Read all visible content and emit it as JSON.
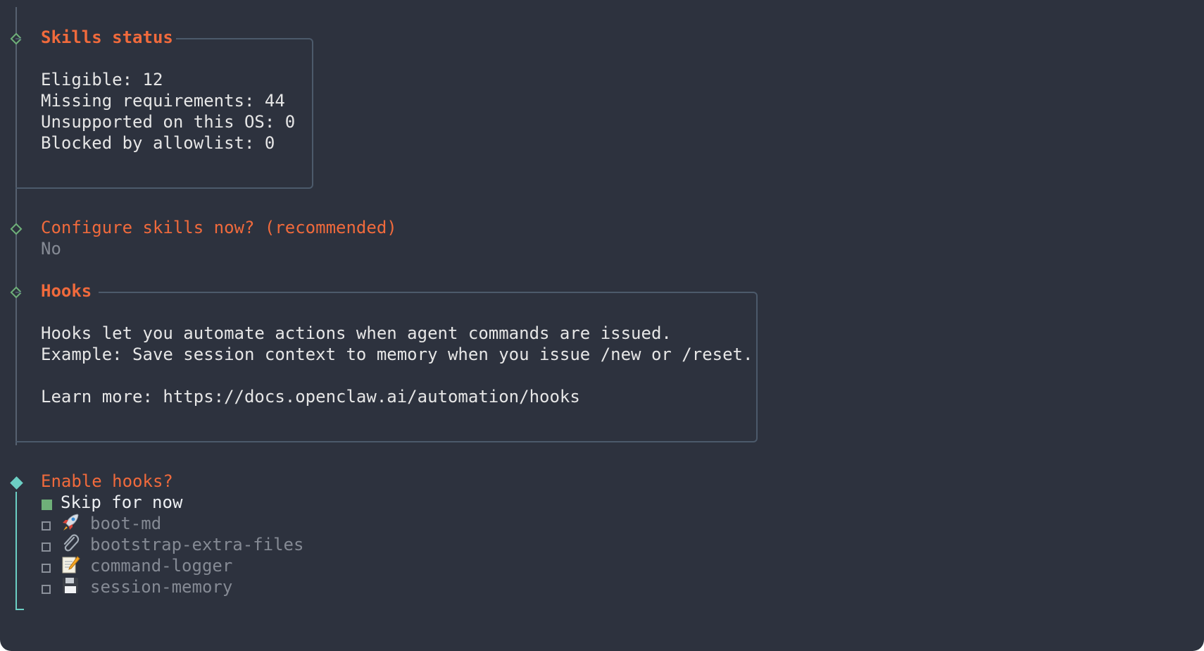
{
  "skills_status": {
    "title": "Skills status",
    "lines": [
      "Eligible: 12",
      "Missing requirements: 44",
      "Unsupported on this OS: 0",
      "Blocked by allowlist: 0"
    ]
  },
  "configure_prompt": {
    "question": "Configure skills now? (recommended)",
    "answer": "No"
  },
  "hooks": {
    "title": "Hooks",
    "lines": [
      "Hooks let you automate actions when agent commands are issued.",
      "Example: Save session context to memory when you issue /new or /reset.",
      "",
      "Learn more: https://docs.openclaw.ai/automation/hooks"
    ]
  },
  "enable_hooks": {
    "question": "Enable hooks?",
    "options": [
      {
        "label": "Skip for now",
        "selected": true,
        "icon": ""
      },
      {
        "label": "boot-md",
        "selected": false,
        "icon": "rocket-icon"
      },
      {
        "label": "bootstrap-extra-files",
        "selected": false,
        "icon": "paperclip-icon"
      },
      {
        "label": "command-logger",
        "selected": false,
        "icon": "memo-icon"
      },
      {
        "label": "session-memory",
        "selected": false,
        "icon": "floppy-disk-icon"
      }
    ]
  },
  "colors": {
    "background": "#2d323e",
    "accent": "#f06a3c",
    "active_gutter": "#6ccfc4",
    "diamond": "#6fb079",
    "border": "#4c5a6b"
  }
}
